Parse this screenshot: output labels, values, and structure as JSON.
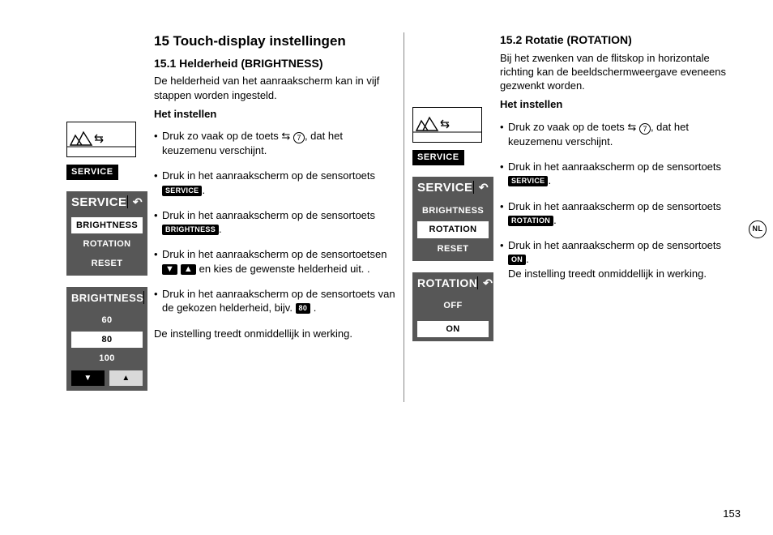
{
  "page_number": "153",
  "lang_tab": "NL",
  "heading": "15 Touch-display instellingen",
  "s151": {
    "title": "15.1 Helderheid (BRIGHTNESS)",
    "intro": "De helderheid van het aanraakscherm kan in vijf stappen worden ingesteld.",
    "subhead": "Het instellen",
    "b1a": "Druk zo vaak op de toets ",
    "b1b": ", dat het keuzemenu verschijnt.",
    "ref7": "7",
    "b2a": "Druk in het aanraakscherm op de sensor­toets ",
    "b2chip": "SERVICE",
    "b2b": ".",
    "b3a": "Druk in het aanraakscherm op de sensor­toets ",
    "b3chip": "BRIGHTNESS",
    "b3b": ".",
    "b4a": "Druk in het aanraakscherm op de sensor­toetsen ",
    "b4b": " en kies de gewenste hel­derheid uit. .",
    "b5a": "Druk in het aanraakscherm op de sensor­toets van de gekozen helderheid, bijv. ",
    "b5chip": "80",
    "b5b": " .",
    "outro": "De instelling treedt onmiddellijk in werking."
  },
  "s152": {
    "title": "15.2 Rotatie (ROTATION)",
    "intro": "Bij het zwenken van de flitskop in horizontale richting kan de beeldschermweergave eve­neens gezwenkt worden.",
    "subhead": "Het instellen",
    "b1a": "Druk zo vaak op de toets ",
    "b1b": ", dat het keuzemenu verschijnt.",
    "ref7": "7",
    "b2a": "Druk in het aanraakscherm op de sensor­toets ",
    "b2chip": "SERVICE",
    "b2b": ".",
    "b3a": "Druk in het aanraakscherm op de sensor­toets  ",
    "b3chip": "ROTATION",
    "b3b": ".",
    "b4a": "Druk in het aanraakscherm op de sensor­toets ",
    "b4chip": "ON",
    "b4b": ".",
    "b4c": "De instelling treedt onmiddellijk in werking."
  },
  "panels": {
    "service_label": "SERVICE",
    "brightness_label": "BRIGHTNESS",
    "rotation_label": "ROTATION",
    "reset_label": "RESET",
    "v60": "60",
    "v80": "80",
    "v100": "100",
    "off": "OFF",
    "on": "ON",
    "down": "▼",
    "up": "▲"
  }
}
